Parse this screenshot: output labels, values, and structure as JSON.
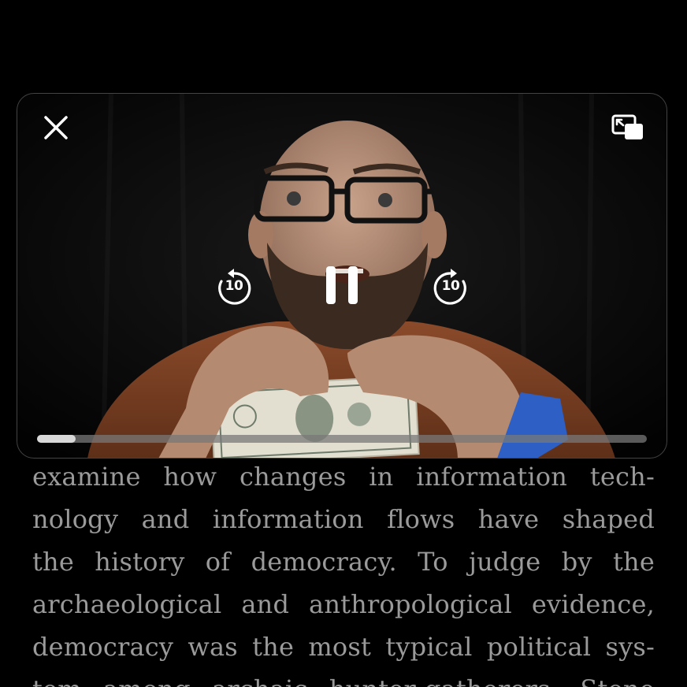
{
  "player": {
    "controls": {
      "close_icon": "close-icon",
      "pip_icon": "picture-in-picture-icon",
      "rewind_icon": "rewind-10-icon",
      "rewind_label": "10",
      "pause_icon": "pause-icon",
      "forward_icon": "forward-10-icon",
      "forward_label": "10"
    },
    "progress_fraction": 0.063
  },
  "reader": {
    "lines": [
      "examine how changes in information tech-",
      "nology and information flows have shaped",
      "the history of democracy. To judge by the",
      "archaeological and anthropological evidence,",
      "democracy was the most typical political sys-",
      "tem among archaic hunter-gatherers. Stone"
    ]
  },
  "colors": {
    "background": "#000000",
    "text": "#9a9a9a",
    "control": "#ffffff",
    "progress_track": "#787878",
    "progress_fill": "#d8d8d8"
  }
}
